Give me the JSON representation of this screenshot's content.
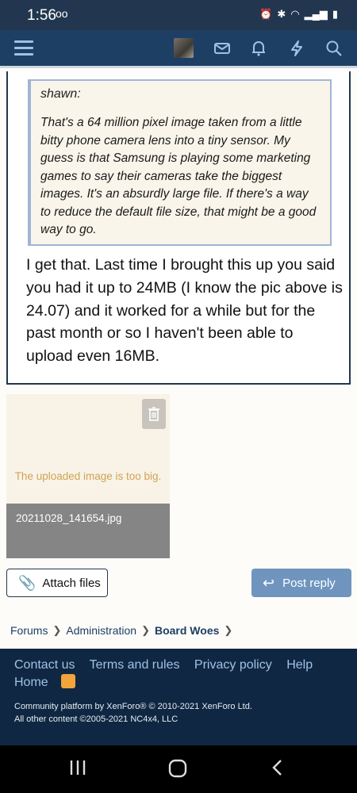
{
  "status_bar": {
    "time": "1:56",
    "voicemail": "oo",
    "icons_right": [
      "alarm-icon",
      "bluetooth-icon",
      "wifi-icon",
      "signal-icon",
      "battery-icon"
    ]
  },
  "navbar": {
    "icons": [
      "menu-icon",
      "avatar",
      "mail-icon",
      "bell-icon",
      "bolt-icon",
      "search-icon"
    ]
  },
  "quote": {
    "author": "shawn:",
    "text": "That's a 64 million pixel image taken from a little bitty phone camera lens into a tiny sensor. My guess is that Samsung is playing some marketing games to say their cameras take the biggest images. It's an absurdly large file. If there's a way to reduce the default file size, that might be a good way to go."
  },
  "reply_text": "I get that. Last time I brought this up you said you had it up to 24MB (I know the pic above is 24.07) and it worked for a while but for the past month or so I haven't been able to upload even 16MB.",
  "attachment": {
    "error": "The uploaded image is too big.",
    "filename": "20211028_141654.jpg"
  },
  "buttons": {
    "attach": "Attach files",
    "post_reply": "Post reply"
  },
  "breadcrumb": {
    "items": [
      "Forums",
      "Administration",
      "Board Woes"
    ]
  },
  "footer": {
    "links": [
      "Contact us",
      "Terms and rules",
      "Privacy policy",
      "Help",
      "Home"
    ],
    "copyright_line1": "Community platform by XenForo® © 2010-2021 XenForo Ltd.",
    "copyright_line2": "All other content ©2005-2021 NC4x4, LLC"
  },
  "colors": {
    "navbar": "#1d3f63",
    "footer": "#0f2742",
    "accent": "#6f95bf",
    "error": "#d0a256"
  }
}
